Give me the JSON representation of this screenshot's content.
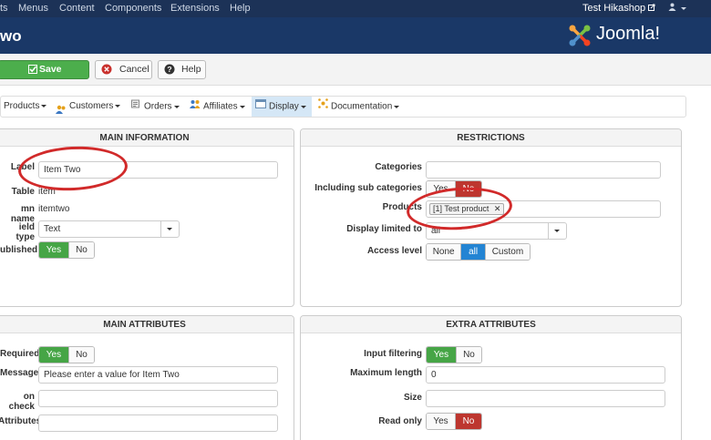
{
  "topbar": {
    "menus": [
      "ts",
      "Menus",
      "Content",
      "Components",
      "Extensions",
      "Help"
    ],
    "user": "Test Hikashop",
    "user_icon": "external-link-icon",
    "account_icon": "user-icon"
  },
  "header": {
    "title": "wo",
    "logo": "Joomla!"
  },
  "toolbar": {
    "save_label": "Save",
    "cancel_label": "Cancel",
    "help_label": "Help"
  },
  "submenu": [
    {
      "label": "Products",
      "icon": ""
    },
    {
      "label": "Customers",
      "icon": "customers-icon"
    },
    {
      "label": "Orders",
      "icon": "orders-icon"
    },
    {
      "label": "Affiliates",
      "icon": "affiliates-icon"
    },
    {
      "label": "Display",
      "icon": "display-icon",
      "active": true
    },
    {
      "label": "Documentation",
      "icon": "documentation-icon"
    }
  ],
  "main_information": {
    "heading": "MAIN INFORMATION",
    "label_label": "Label",
    "label_value": "Item Two",
    "table_label": "Table",
    "table_value": "item",
    "column_label": "mn name",
    "column_value": "itemtwo",
    "field_type_label": "ield type",
    "field_type_value": "Text",
    "published_label": "ublished",
    "yes": "Yes",
    "no": "No"
  },
  "restrictions": {
    "heading": "RESTRICTIONS",
    "categories_label": "Categories",
    "sub_categories_label": "Including sub categories",
    "yes": "Yes",
    "no": "No",
    "products_label": "Products",
    "product_tag": "[1] Test product",
    "display_limited_label": "Display limited to",
    "display_limited_value": "all",
    "access_level_label": "Access level",
    "access_none": "None",
    "access_all": "all",
    "access_custom": "Custom"
  },
  "main_attributes": {
    "heading": "MAIN ATTRIBUTES",
    "required_label": "Required",
    "yes": "Yes",
    "no": "No",
    "message_label": "Message",
    "message_value": "Please enter a value for Item Two",
    "check_label": "on check",
    "attributes_label": "Attributes"
  },
  "extra_attributes": {
    "heading": "EXTRA ATTRIBUTES",
    "input_filtering_label": "Input filtering",
    "yes": "Yes",
    "no": "No",
    "max_length_label": "Maximum length",
    "max_length_value": "0",
    "size_label": "Size",
    "read_only_label": "Read only"
  },
  "colors": {
    "menubar": "#1c3257",
    "header": "#1a3867",
    "save": "#4cae4c",
    "yes_active": "#46a546",
    "no_active": "#bd362f",
    "all_active": "#2384d3",
    "annotation": "#d12a2a"
  }
}
